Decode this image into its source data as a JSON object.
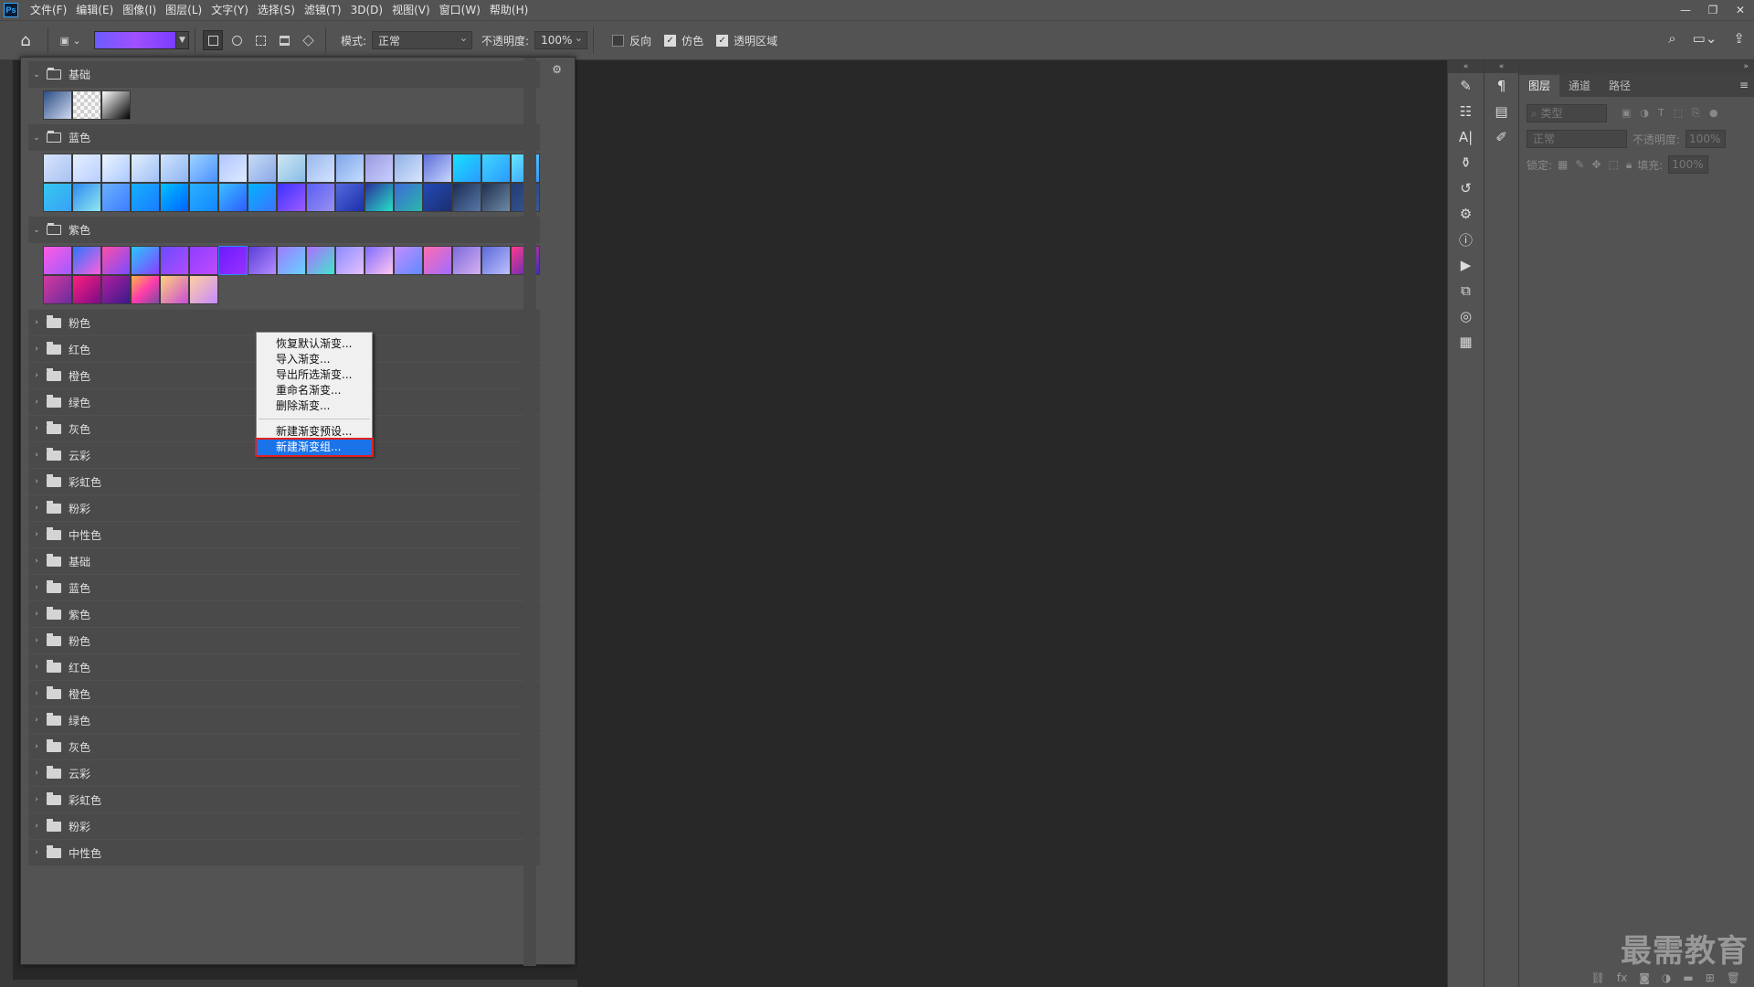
{
  "menubar": {
    "logo": "Ps",
    "items": [
      "文件(F)",
      "编辑(E)",
      "图像(I)",
      "图层(L)",
      "文字(Y)",
      "选择(S)",
      "滤镜(T)",
      "3D(D)",
      "视图(V)",
      "窗口(W)",
      "帮助(H)"
    ],
    "window_controls": [
      "—",
      "❐",
      "✕"
    ]
  },
  "options": {
    "mode_label": "模式:",
    "mode_value": "正常",
    "opacity_label": "不透明度:",
    "opacity_value": "100%",
    "reverse_label": "反向",
    "reverse_checked": false,
    "dither_label": "仿色",
    "dither_checked": true,
    "transparency_label": "透明区域",
    "transparency_checked": true,
    "accent_color": "#1a73e8",
    "highlight_outline": "#e02020"
  },
  "gradient_panel": {
    "expanded_groups": [
      {
        "name": "基础",
        "swatches": [
          "linear-gradient(135deg,#2c4f85,#cfd9ef)",
          "repeating-conic-gradient(#cfcfcf 0 25%,#f7f7f7 0 50%) 0 0/8px 8px",
          "linear-gradient(135deg,#ffffff,#000000)"
        ]
      },
      {
        "name": "蓝色",
        "swatches": [
          "linear-gradient(135deg,#d8e4ff,#a8c2f0)",
          "linear-gradient(135deg,#e6efff,#b9cfff)",
          "linear-gradient(135deg,#eef4ff,#a9c9ff)",
          "linear-gradient(135deg,#e3efff,#9fc0f5)",
          "linear-gradient(135deg,#cfe4ff,#8fb4f0)",
          "linear-gradient(135deg,#9fd3ff,#4a90ff)",
          "linear-gradient(135deg,#b0c6ff,#ddeaff)",
          "linear-gradient(135deg,#c6dcf6,#8aa8e6)",
          "linear-gradient(135deg,#cfe6f3,#87bde6)",
          "linear-gradient(135deg,#99b8ec,#d3e2ff)",
          "linear-gradient(135deg,#7fa6ea,#c4dcff)",
          "linear-gradient(135deg,#9a9ae0,#c8cfff)",
          "linear-gradient(135deg,#8fb0e6,#d9e5ff)",
          "linear-gradient(135deg,#5d6fd8,#c9d6ff)",
          "linear-gradient(135deg,#16e0ff,#2b9bff)",
          "linear-gradient(135deg,#3fd5ff,#2a9bff)",
          "linear-gradient(135deg,#66e6ff,#2f96ff)",
          "linear-gradient(135deg,#33c8f0,#3aa0f6)",
          "linear-gradient(135deg,#2f8af0,#8ee8f0)",
          "linear-gradient(135deg,#6ab0ff,#3d7dff)",
          "linear-gradient(135deg,#14b0ff,#1a7cff)",
          "linear-gradient(135deg,#00c2ff,#0060ff)",
          "linear-gradient(135deg,#29b0ff,#1287ff)",
          "linear-gradient(135deg,#3ac0ff,#2c5dff)",
          "linear-gradient(135deg,#00b4ff,#3d72ff)",
          "linear-gradient(135deg,#3b33ff,#9d5bff)",
          "linear-gradient(135deg,#5a5ff5,#9990f0)",
          "linear-gradient(135deg,#5468e0,#1b2fa8)",
          "linear-gradient(135deg,#2a2f9a,#26e0c8)",
          "linear-gradient(135deg,#3d6ad8,#2ab8a8)",
          "linear-gradient(135deg,#2449b5,#1b2f70)",
          "linear-gradient(135deg,#1c2d55,#5877a6)",
          "linear-gradient(135deg,#20304e,#6d8aa8)",
          "linear-gradient(135deg,#233c73,#3a5a96)"
        ]
      },
      {
        "name": "紫色",
        "swatches": [
          "linear-gradient(135deg,#ff5be0,#9f5bff)",
          "linear-gradient(135deg,#2b76ff,#ff5fde)",
          "linear-gradient(135deg,#ff4fa8,#7a4bff)",
          "linear-gradient(135deg,#28c8ff,#8a3dff)",
          "linear-gradient(135deg,#6a4bff,#b24bff)",
          "linear-gradient(135deg,#8e3dff,#c04bff)",
          "linear-gradient(135deg,#6a1cff,#9b30ff)",
          "linear-gradient(135deg,#5a3dd8,#b48cff)",
          "linear-gradient(135deg,#9d7bff,#67d2ff)",
          "linear-gradient(135deg,#b16bff,#43e6d0)",
          "linear-gradient(135deg,#8b8bff,#e5c0ff)",
          "linear-gradient(135deg,#7f6bff,#ffc6f0)",
          "linear-gradient(135deg,#c48cff,#5e8bff)",
          "linear-gradient(135deg,#ff6db0,#a06bff)",
          "linear-gradient(135deg,#7d6bdd,#d5b0f0)",
          "linear-gradient(135deg,#5a6ad8,#c0c0ff)",
          "linear-gradient(135deg,#ff3a8c,#3b2cc0)",
          "linear-gradient(135deg,#d53a9d,#6a2b9f)",
          "linear-gradient(135deg,#ff1f7c,#7a0a8a)",
          "linear-gradient(135deg,#b21ea0,#3a1a8a)",
          "linear-gradient(135deg,#ffb347,#ff3cac,#784ba0)",
          "linear-gradient(135deg,#ffd27a,#c94bd8)",
          "linear-gradient(135deg,#ffcf9f,#c78aff)"
        ]
      }
    ],
    "collapsed_groups": [
      "粉色",
      "红色",
      "橙色",
      "绿色",
      "灰色",
      "云彩",
      "彩虹色",
      "粉彩",
      "中性色",
      "基础",
      "蓝色",
      "紫色",
      "粉色",
      "红色",
      "橙色",
      "绿色",
      "灰色",
      "云彩",
      "彩虹色",
      "粉彩",
      "中性色"
    ]
  },
  "context_menu": {
    "items": [
      "恢复默认渐变...",
      "导入渐变...",
      "导出所选渐变...",
      "重命名渐变...",
      "删除渐变..."
    ],
    "items2": [
      "新建渐变预设...",
      "新建渐变组..."
    ],
    "highlighted": "新建渐变组..."
  },
  "layers_panel": {
    "tabs": [
      "图层",
      "通道",
      "路径"
    ],
    "filter_placeholder": "类型",
    "blend_mode": "正常",
    "opacity_label": "不透明度:",
    "opacity_value": "100%",
    "lock_label": "锁定:",
    "fill_label": "填充:",
    "fill_value": "100%"
  },
  "watermark": "最需教育"
}
